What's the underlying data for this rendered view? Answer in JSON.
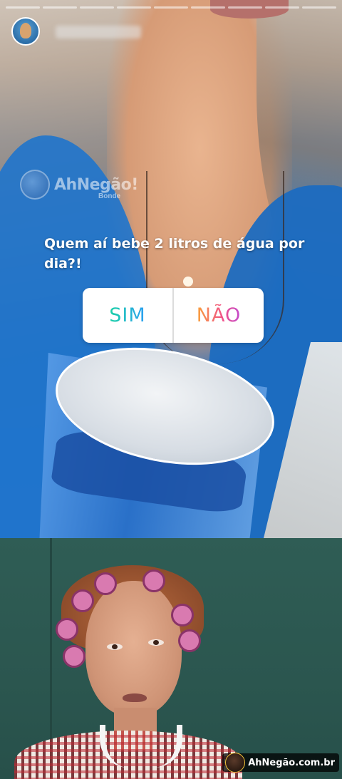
{
  "story": {
    "progress_segments": 9,
    "question": "Quem aí bebe 2 litros de água por dia?!",
    "poll": {
      "yes_label": "SIM",
      "no_label": "NÃO"
    },
    "watermark": {
      "brand": "AhNegão!",
      "sub": "Bonde"
    }
  },
  "footer": {
    "watermark": "AhNegão.com.br"
  },
  "colors": {
    "yes_gradient": [
      "#1ad1a5",
      "#2a9df4"
    ],
    "no_gradient": [
      "#f9a13a",
      "#f0508a",
      "#c04bd0"
    ],
    "shirt_blue": "#1f74cc",
    "wall_green": "#2f5d55"
  },
  "icons": [
    "avatar",
    "watermark-face-icon",
    "watermark-logo-icon"
  ]
}
